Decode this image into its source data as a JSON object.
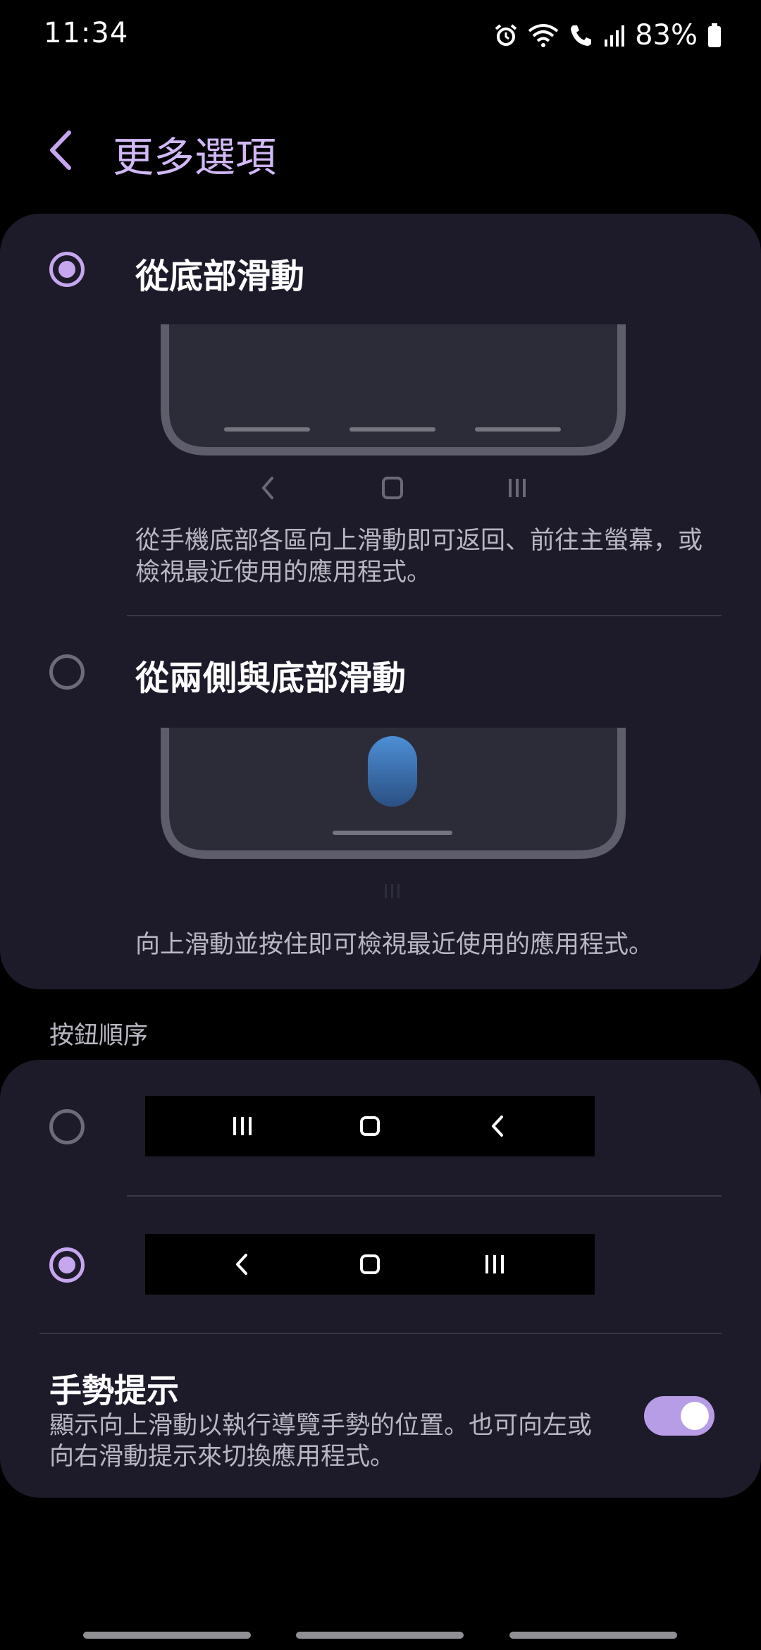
{
  "status_bar": {
    "time": "11:34",
    "battery_percent": "83%",
    "icons": [
      "alarm-icon",
      "wifi-icon",
      "wifi-calling-icon",
      "signal-icon",
      "battery-icon"
    ]
  },
  "header": {
    "back_icon": "chevron-left-icon",
    "title": "更多選項"
  },
  "swipe_options": [
    {
      "label": "從底部滑動",
      "selected": true,
      "description": "從手機底部各區向上滑動即可返回、前往主螢幕，或檢視最近使用的應用程式。"
    },
    {
      "label": "從兩側與底部滑動",
      "selected": false,
      "description": "向上滑動並按住即可檢視最近使用的應用程式。"
    }
  ],
  "button_order": {
    "section_label": "按鈕順序",
    "options": [
      {
        "order": [
          "recents-icon",
          "home-icon",
          "back-icon"
        ],
        "selected": false
      },
      {
        "order": [
          "back-icon",
          "home-icon",
          "recents-icon"
        ],
        "selected": true
      }
    ]
  },
  "gesture_hint": {
    "title": "手勢提示",
    "description": "顯示向上滑動以執行導覽手勢的位置。也可向左或向右滑動提示來切換應用程式。",
    "enabled": true
  },
  "colors": {
    "accent": "#c7a6f0",
    "title_accent": "#d1b8f6",
    "card_background": "#1d1b29",
    "toggle_on": "#b79ce6"
  }
}
